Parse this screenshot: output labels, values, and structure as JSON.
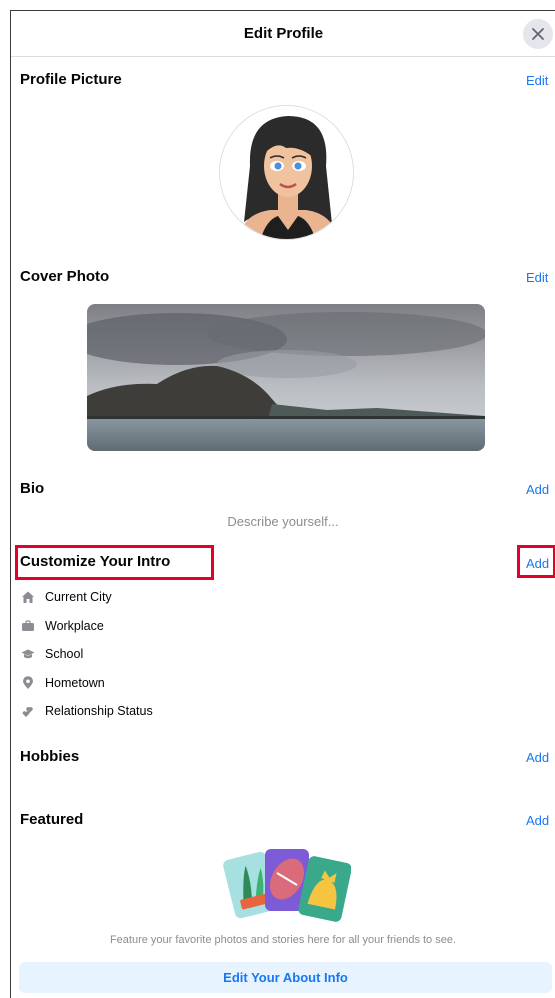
{
  "header": {
    "title": "Edit Profile",
    "close_icon": "close-icon"
  },
  "sections": {
    "profile_picture": {
      "title": "Profile Picture",
      "action": "Edit"
    },
    "cover_photo": {
      "title": "Cover Photo",
      "action": "Edit"
    },
    "bio": {
      "title": "Bio",
      "action": "Add",
      "placeholder": "Describe yourself..."
    },
    "intro": {
      "title": "Customize Your Intro",
      "action": "Add",
      "items": [
        {
          "label": "Current City",
          "icon": "home-icon"
        },
        {
          "label": "Workplace",
          "icon": "briefcase-icon"
        },
        {
          "label": "School",
          "icon": "graduation-cap-icon"
        },
        {
          "label": "Hometown",
          "icon": "location-pin-icon"
        },
        {
          "label": "Relationship Status",
          "icon": "hearts-icon"
        }
      ]
    },
    "hobbies": {
      "title": "Hobbies",
      "action": "Add"
    },
    "featured": {
      "title": "Featured",
      "action": "Add",
      "caption": "Feature your favorite photos and stories here for all your friends to see."
    }
  },
  "footer": {
    "button_label": "Edit Your About Info"
  },
  "colors": {
    "accent": "#1877f2",
    "highlight": "#e4002b",
    "muted_text": "#8a8d91",
    "button_bg": "#e7f3ff"
  }
}
